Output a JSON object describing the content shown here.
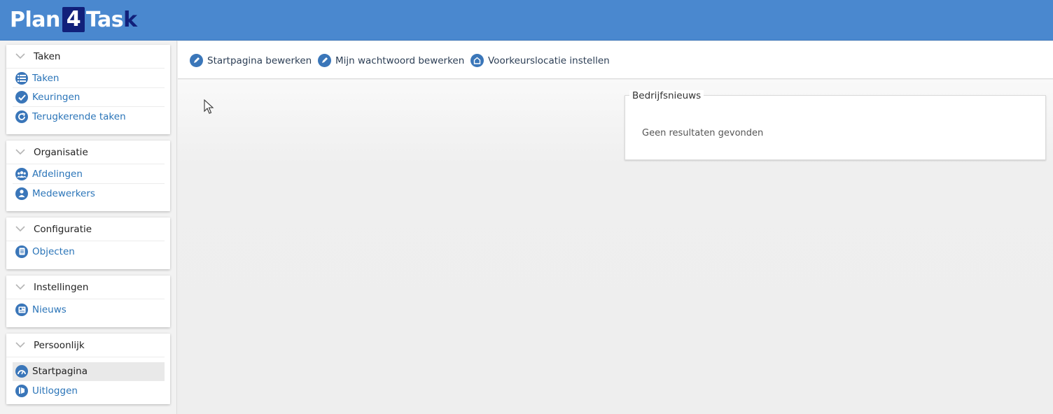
{
  "app": {
    "logo_prefix": "Plan",
    "logo_num": "4",
    "logo_suffix": "Tas",
    "logo_k": "k"
  },
  "sidebar": {
    "panels": [
      {
        "title": "Taken",
        "items": [
          {
            "label": "Taken",
            "icon": "list-icon"
          },
          {
            "label": "Keuringen",
            "icon": "check-icon"
          },
          {
            "label": "Terugkerende taken",
            "icon": "refresh-icon"
          }
        ]
      },
      {
        "title": "Organisatie",
        "items": [
          {
            "label": "Afdelingen",
            "icon": "group-icon"
          },
          {
            "label": "Medewerkers",
            "icon": "user-icon"
          }
        ]
      },
      {
        "title": "Configuratie",
        "items": [
          {
            "label": "Objecten",
            "icon": "document-icon"
          }
        ]
      },
      {
        "title": "Instellingen",
        "items": [
          {
            "label": "Nieuws",
            "icon": "news-icon"
          }
        ]
      },
      {
        "title": "Persoonlijk",
        "items": [
          {
            "label": "Startpagina",
            "icon": "dashboard-icon",
            "active": true
          },
          {
            "label": "Uitloggen",
            "icon": "logout-icon"
          }
        ]
      }
    ]
  },
  "toolbar": {
    "edit_start": "Startpagina bewerken",
    "edit_password": "Mijn wachtwoord bewerken",
    "set_location": "Voorkeurslocatie instellen"
  },
  "news": {
    "title": "Bedrijfsnieuws",
    "empty": "Geen resultaten gevonden"
  },
  "colors": {
    "header": "#4a88cf",
    "link": "#2a74b8",
    "icon": "#3a76b9"
  }
}
